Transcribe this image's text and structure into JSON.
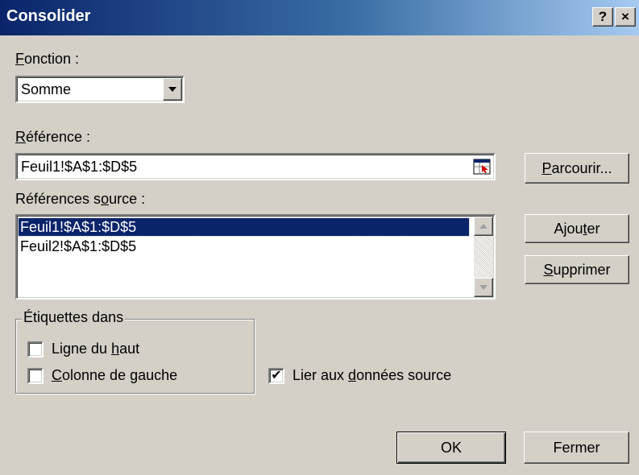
{
  "window": {
    "title": "Consolider",
    "help_glyph": "?",
    "close_glyph": "×"
  },
  "fonction": {
    "label_mnemonic": "F",
    "label_rest": "onction :",
    "value": "Somme"
  },
  "reference": {
    "label_mnemonic": "R",
    "label_rest": "éférence :",
    "value": "Feuil1!$A$1:$D$5"
  },
  "parcourir": {
    "mnemonic": "P",
    "rest": "arcourir..."
  },
  "sources": {
    "label_a": "Références s",
    "label_mnemonic": "o",
    "label_b": "urce :",
    "items": [
      "Feuil1!$A$1:$D$5",
      "Feuil2!$A$1:$D$5"
    ],
    "selected_index": 0
  },
  "ajouter": {
    "a": "Ajou",
    "mnemonic": "t",
    "b": "er"
  },
  "supprimer": {
    "mnemonic": "S",
    "rest": "upprimer"
  },
  "etiquettes": {
    "legend": "Étiquettes dans",
    "ligne": {
      "a": "Ligne du ",
      "mnemonic": "h",
      "b": "aut",
      "checked": false
    },
    "colonne": {
      "mnemonic": "C",
      "rest": "olonne de gauche",
      "checked": false
    }
  },
  "lier": {
    "a": "Lier aux ",
    "mnemonic": "d",
    "b": "onnées source",
    "checked": true,
    "check_glyph": "✔"
  },
  "ok_label": "OK",
  "fermer_label": "Fermer",
  "colors": {
    "title_active": "#0a246a",
    "face": "#d4d0c8",
    "selection": "#0a246a"
  }
}
